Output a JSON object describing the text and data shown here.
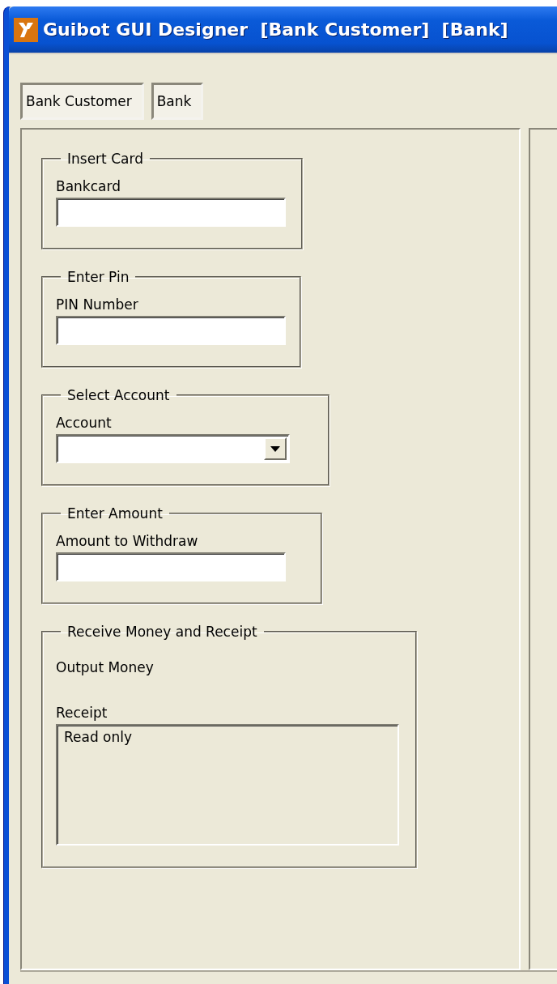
{
  "window": {
    "title": "Guibot GUI Designer  [Bank Customer]  [Bank]"
  },
  "tabs": [
    {
      "label": "Bank Customer"
    },
    {
      "label": "Bank"
    }
  ],
  "groups": [
    {
      "title": "Insert Card",
      "items": [
        {
          "kind": "text",
          "label": "Bankcard"
        }
      ]
    },
    {
      "title": "Enter Pin",
      "items": [
        {
          "kind": "text",
          "label": "PIN Number"
        }
      ]
    },
    {
      "title": "Select Account",
      "items": [
        {
          "kind": "dropdown",
          "label": "Account"
        }
      ]
    },
    {
      "title": "Enter Amount",
      "items": [
        {
          "kind": "text",
          "label": "Amount to Withdraw"
        }
      ]
    },
    {
      "title": "Receive Money and Receipt",
      "items": [
        {
          "kind": "label",
          "text": "Output Money"
        },
        {
          "kind": "textarea",
          "label": "Receipt",
          "value": "Read only"
        }
      ]
    }
  ]
}
